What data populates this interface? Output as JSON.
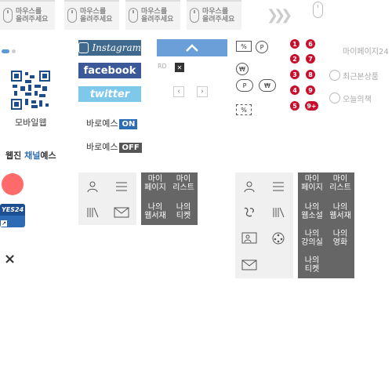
{
  "hints": [
    {
      "line1": "마우스를",
      "line2": "올려주세요"
    },
    {
      "line1": "마우스를",
      "line2": "올려주세요"
    },
    {
      "line1": "마우스를",
      "line2": "올려주세요"
    },
    {
      "line1": "마우스를",
      "line2": "올려주세요"
    }
  ],
  "left": {
    "mobile_web_label": "모바일웹",
    "channel_prefix": "웹진 ",
    "channel_highlight": "채널",
    "channel_suffix": "예스",
    "yes24_logo": "YES24",
    "close_glyph": "×"
  },
  "social": {
    "instagram": "Instagram",
    "facebook": "facebook",
    "twitter": "twitter"
  },
  "toggles": [
    {
      "label": "바로예스",
      "state": "ON",
      "color": "#2a6db5"
    },
    {
      "label": "바로예스",
      "state": "OFF",
      "color": "#555555"
    }
  ],
  "controls": {
    "rd_label": "RD",
    "x_glyph": "✕",
    "prev_glyph": "‹",
    "next_glyph": "›"
  },
  "badges": {
    "percent": "%",
    "point": "P",
    "won": "₩",
    "point_plus": "P",
    "won_plus": "₩",
    "coupon": "%"
  },
  "numbers": [
    "1",
    "2",
    "3",
    "4",
    "5",
    "6",
    "7",
    "8",
    "9",
    "9+"
  ],
  "ghost_menu": [
    "마이페이지24",
    "최근본상품",
    "오늘의책"
  ],
  "menu_small": {
    "items": [
      {
        "line1": "마이",
        "line2": "페이지"
      },
      {
        "line1": "마이",
        "line2": "리스트"
      },
      {
        "line1": "나의",
        "line2": "웹서재"
      },
      {
        "line1": "나의",
        "line2": "티켓"
      }
    ]
  },
  "menu_large": {
    "items": [
      {
        "line1": "마이",
        "line2": "페이지"
      },
      {
        "line1": "마이",
        "line2": "리스트"
      },
      {
        "line1": "나의",
        "line2": "웹소설"
      },
      {
        "line1": "나의",
        "line2": "웹서재"
      },
      {
        "line1": "나의",
        "line2": "강의실"
      },
      {
        "line1": "나의",
        "line2": "영화"
      },
      {
        "line1": "나의",
        "line2": "티켓"
      }
    ]
  },
  "colors": {
    "accent_red": "#c8102e",
    "coral": "#ff6b6b",
    "instagram": "#3f6a8e",
    "facebook": "#3b5998",
    "twitter": "#7ec8ea"
  }
}
